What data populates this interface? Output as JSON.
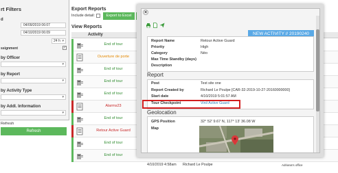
{
  "sidebar": {
    "title": "rt Filters",
    "field_label": "d",
    "date_from": "04/09/2019 06:07",
    "date_to": "04/10/2019 06:09",
    "hours": "24 h",
    "assignment_label": "ssignment",
    "by_officer": "by Officer",
    "by_report": "by Report",
    "by_activity_type": "by Activity Type",
    "by_addl_info": "by Addl. Information",
    "refresh_link": "Refresh",
    "refresh_button": "Refresh"
  },
  "export": {
    "title": "Export Reports",
    "include_detail": "Include detail:",
    "export_excel": "Export to Excel",
    "export_other": "Ex"
  },
  "reports": {
    "title": "View Reports",
    "columns": [
      "Activity",
      "D"
    ],
    "rows": [
      {
        "activity": "End of tour",
        "color": "green"
      },
      {
        "activity": "Ouverture de porte",
        "color": "orange"
      },
      {
        "activity": "End of tour",
        "color": "green"
      },
      {
        "activity": "End of tour",
        "color": "green"
      },
      {
        "activity": "End of tour",
        "color": "green"
      },
      {
        "activity": "Alarms23",
        "color": "red"
      },
      {
        "activity": "End of tour",
        "color": "green"
      },
      {
        "activity": "Retour Active Guard",
        "color": "red"
      },
      {
        "activity": "End of tour",
        "color": "green"
      },
      {
        "activity": "End of tour",
        "color": "green"
      }
    ],
    "last_row": {
      "datetime": "4/10/2019 4:58am",
      "officer": "Richard Le Poulpe",
      "site": "Adriana's office"
    }
  },
  "modal": {
    "close": "×",
    "banner": "NEW ACTIVITY // 20190240",
    "fields": [
      {
        "label": "Report Name",
        "value": "Retour Active Guard"
      },
      {
        "label": "Priority",
        "value": "High"
      },
      {
        "label": "Category",
        "value": "Néo"
      },
      {
        "label": "Max Time Standby (days)",
        "value": ""
      },
      {
        "label": "Description",
        "value": ""
      }
    ],
    "report_section": "Report",
    "report_fields": [
      {
        "label": "Post",
        "value": "Test site one"
      },
      {
        "label": "Report Created by",
        "value": "Richard Le Poulpe [CAR-32-2019-10-27-20160000000]"
      },
      {
        "label": "Start date",
        "value": "4/10/2019 5:01:57 AM"
      },
      {
        "label": "Tour Checkpoint",
        "value": "Vinil Active Guard"
      }
    ],
    "geo_section": "Geolocation",
    "gps_label": "GPS Position",
    "gps_value": "32° 52' 9.67 N, 117° 13' 36.08 W",
    "map_label": "Map"
  }
}
